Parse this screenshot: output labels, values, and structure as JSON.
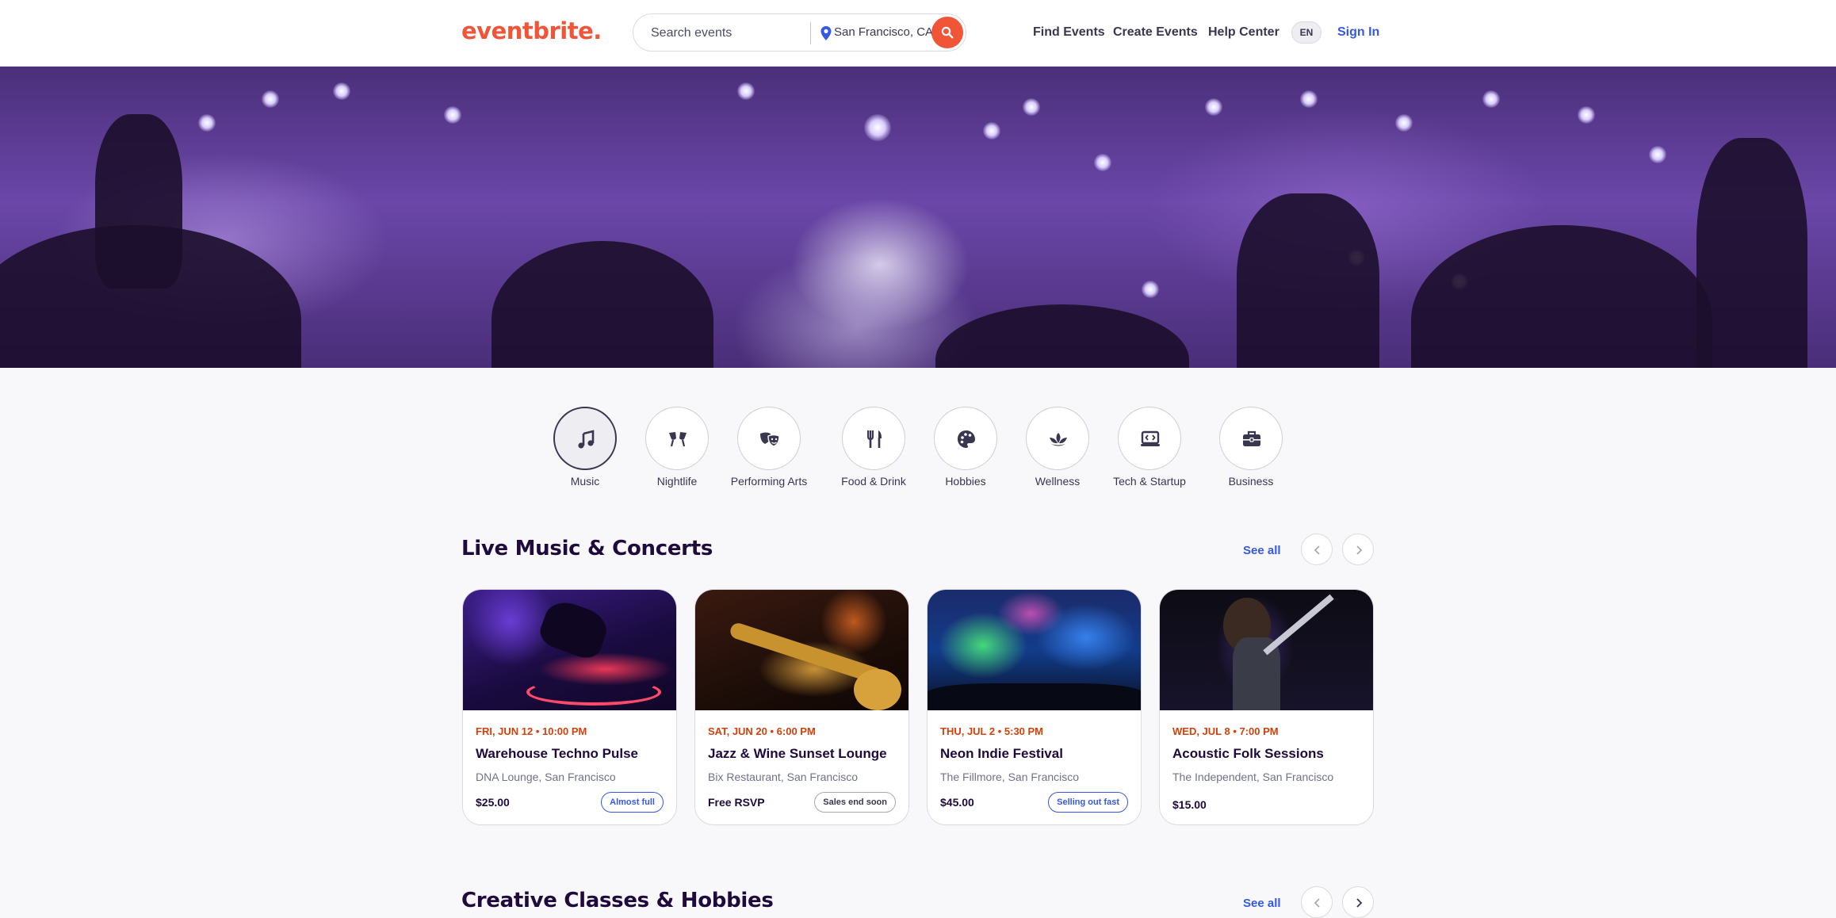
{
  "header": {
    "logo": "eventbrite.",
    "search_placeholder": "Search events",
    "location": "San Francisco, CA",
    "nav": [
      "Find Events",
      "Create Events",
      "Help Center"
    ],
    "language": "EN",
    "sign_in": "Sign In"
  },
  "categories": [
    {
      "label": "Music",
      "icon": "music-note-icon",
      "active": true
    },
    {
      "label": "Nightlife",
      "icon": "cheers-icon",
      "active": false
    },
    {
      "label": "Performing Arts",
      "icon": "theater-masks-icon",
      "active": false
    },
    {
      "label": "Food & Drink",
      "icon": "fork-knife-icon",
      "active": false
    },
    {
      "label": "Hobbies",
      "icon": "palette-icon",
      "active": false
    },
    {
      "label": "Wellness",
      "icon": "lotus-icon",
      "active": false
    },
    {
      "label": "Tech & Startup",
      "icon": "laptop-code-icon",
      "active": false
    },
    {
      "label": "Business",
      "icon": "briefcase-icon",
      "active": false
    }
  ],
  "sections": [
    {
      "title": "Live Music & Concerts",
      "see_all": "See all",
      "events": [
        {
          "date": "FRI, JUN 12 • 10:00 PM",
          "title": "Warehouse Techno Pulse",
          "venue": "DNA Lounge, San Francisco",
          "price": "$25.00",
          "badge": "Almost full",
          "badge_style": "blue"
        },
        {
          "date": "SAT, JUN 20 • 6:00 PM",
          "title": "Jazz & Wine Sunset Lounge",
          "venue": "Bix Restaurant, San Francisco",
          "price": "Free RSVP",
          "badge": "Sales end soon",
          "badge_style": "gray"
        },
        {
          "date": "THU, JUL 2 • 5:30 PM",
          "title": "Neon Indie Festival",
          "venue": "The Fillmore, San Francisco",
          "price": "$45.00",
          "badge": "Selling out fast",
          "badge_style": "blue"
        },
        {
          "date": "WED, JUL 8 • 7:00 PM",
          "title": "Acoustic Folk Sessions",
          "venue": "The Independent, San Francisco",
          "price": "$15.00",
          "badge": "",
          "badge_style": ""
        }
      ]
    },
    {
      "title": "Creative Classes & Hobbies",
      "see_all": "See all"
    }
  ],
  "colors": {
    "brand": "#f05537",
    "link": "#3659e3",
    "date": "#d1410c",
    "text": "#1e0a3c"
  }
}
